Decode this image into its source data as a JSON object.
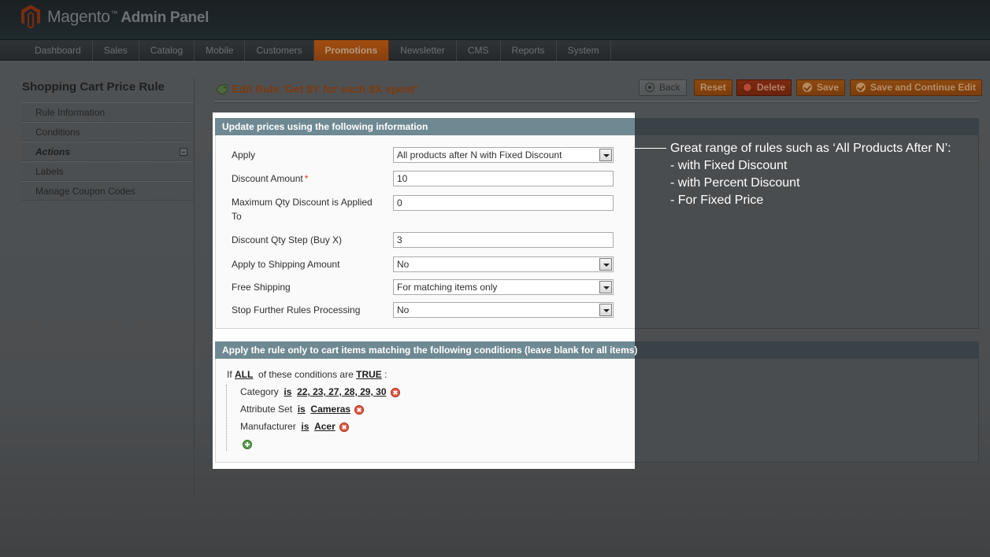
{
  "app": {
    "brand": "Magento",
    "trademark": "™",
    "panel": "Admin Panel"
  },
  "nav": {
    "items": [
      "Dashboard",
      "Sales",
      "Catalog",
      "Mobile",
      "Customers",
      "Promotions",
      "Newsletter",
      "CMS",
      "Reports",
      "System"
    ],
    "active": "Promotions"
  },
  "sidebar": {
    "title": "Shopping Cart Price Rule",
    "items": [
      {
        "label": "Rule Information"
      },
      {
        "label": "Conditions"
      },
      {
        "label": "Actions"
      },
      {
        "label": "Labels"
      },
      {
        "label": "Manage Coupon Codes"
      }
    ],
    "active": "Actions"
  },
  "page": {
    "title": "Edit Rule 'Get $Y for each $X spent'"
  },
  "buttons": {
    "back": "Back",
    "reset": "Reset",
    "delete": "Delete",
    "save": "Save",
    "save_continue": "Save and Continue Edit"
  },
  "actions_section": {
    "heading": "Update prices using the following information",
    "fields": {
      "apply": {
        "label": "Apply",
        "value": "All products after N with Fixed Discount"
      },
      "discount_amount": {
        "label": "Discount Amount",
        "required_mark": "*",
        "value": "10"
      },
      "max_qty": {
        "label": "Maximum Qty Discount is Applied To",
        "value": "0"
      },
      "qty_step": {
        "label": "Discount Qty Step (Buy X)",
        "value": "3"
      },
      "apply_shipping": {
        "label": "Apply to Shipping Amount",
        "value": "No"
      },
      "free_shipping": {
        "label": "Free Shipping",
        "value": "For matching items only"
      },
      "stop_rules": {
        "label": "Stop Further Rules Processing",
        "value": "No"
      }
    }
  },
  "conditions_section": {
    "heading": "Apply the rule only to cart items matching the following conditions (leave blank for all items)",
    "if_text": "If",
    "aggregator": "ALL",
    "middle_text": "of these conditions are",
    "value": "TRUE",
    "colon": ":",
    "conditions": [
      {
        "attribute": "Category",
        "operator": "is",
        "value": "22, 23, 27, 28, 29, 30"
      },
      {
        "attribute": "Attribute Set",
        "operator": "is",
        "value": "Cameras"
      },
      {
        "attribute": "Manufacturer",
        "operator": "is",
        "value": "Acer"
      }
    ]
  },
  "annotation": {
    "line1": "Great range of rules such as ‘All Products After N’:",
    "line2": "- with Fixed Discount",
    "line3": "- with Percent Discount",
    "line4": "- For Fixed Price"
  },
  "colors": {
    "header_bg": "#1d2528",
    "nav_active": "#a24d10",
    "section_head": "#6f8992",
    "title_text": "#7b3a10",
    "required": "#eb340a"
  }
}
